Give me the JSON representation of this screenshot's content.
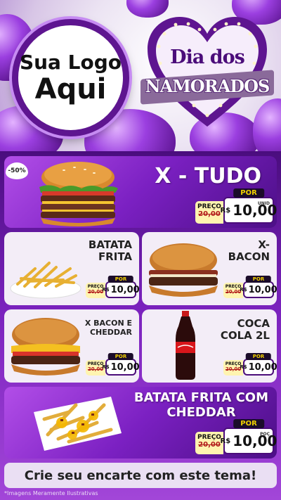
{
  "logo": {
    "line1": "Sua Logo",
    "line2": "Aqui"
  },
  "campaign": {
    "line1": "Dia dos",
    "line2": "NAMORADOS"
  },
  "badge": "-50%",
  "labels": {
    "preco": "PREÇO",
    "por": "POR",
    "currency": "R$",
    "unit": "UNID"
  },
  "featured": {
    "name": "X - TUDO",
    "old_price": "20,00",
    "new_price": "10,00",
    "unit": "UNID"
  },
  "items": [
    {
      "name_line1": "BATATA",
      "name_line2": "FRITA",
      "old_price": "20,00",
      "new_price": "10,00"
    },
    {
      "name_line1": "X-",
      "name_line2": "BACON",
      "old_price": "20,00",
      "new_price": "10,00"
    },
    {
      "name_line1": "X BACON E",
      "name_line2": "CHEDDAR",
      "old_price": "20,00",
      "new_price": "10,00"
    },
    {
      "name_line1": "COCA",
      "name_line2": "COLA 2L",
      "old_price": "20,00",
      "new_price": "10,00"
    }
  ],
  "bottom_item": {
    "name_line1": "BATATA FRITA COM",
    "name_line2": "CHEDDAR",
    "old_price": "20,00",
    "new_price": "10,00",
    "unit": "POÇ"
  },
  "cta": "Crie seu encarte com este tema!",
  "disclaimer": "*Imagens Meramente Ilustrativas",
  "colors": {
    "primary": "#7b20c2",
    "dark": "#4b0d7a",
    "accent_yellow": "#f2d100",
    "old_price_red": "#b21b1b"
  }
}
